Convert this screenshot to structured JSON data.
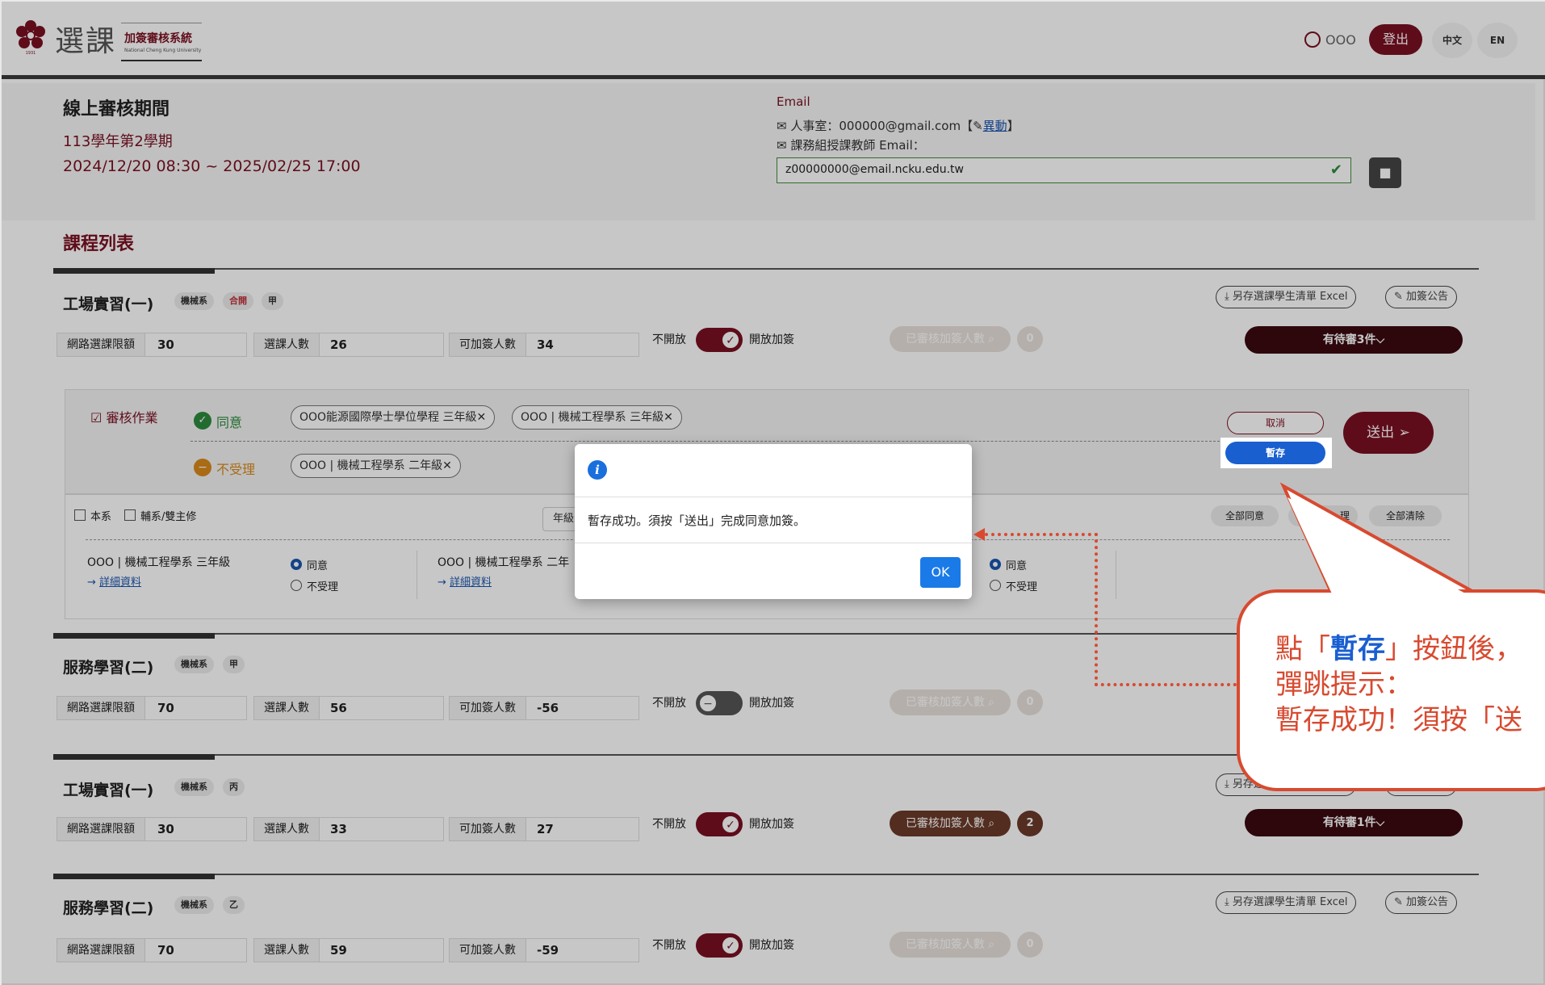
{
  "header": {
    "logo_main": "選課",
    "logo_sub": "加簽審核系統",
    "logo_tiny": "National Cheng Kung University",
    "user_name": "OOO",
    "logout_label": "登出",
    "lang_zh": "中文",
    "lang_en": "EN"
  },
  "period": {
    "title": "線上審核期間",
    "term": "113學年第2學期",
    "range": "2024/12/20 08:30 ~ 2025/02/25 17:00"
  },
  "email": {
    "label": "Email",
    "hr_line": "人事室：000000@gmail.com【",
    "hr_edit": "異動",
    "hr_close": "】",
    "teacher_line": "課務組授課教師 Email：",
    "teacher_value": "z00000000@email.ncku.edu.tw"
  },
  "list_title": "課程列表",
  "labels": {
    "limit": "網路選課限額",
    "enrolled": "選課人數",
    "addable": "可加簽人數",
    "closed": "不開放",
    "open": "開放加簽",
    "reviewed": "已審核加簽人數",
    "export": "另存選課學生清單 Excel",
    "announce": "加簽公告"
  },
  "courses": [
    {
      "name": "工場實習(一)",
      "tags": [
        "機械系",
        "合開",
        "甲"
      ],
      "limit": "30",
      "enrolled": "26",
      "addable": "34",
      "reviewed_count": "0",
      "pending": "有待審3件"
    },
    {
      "name": "服務學習(二)",
      "tags": [
        "機械系",
        "甲"
      ],
      "limit": "70",
      "enrolled": "56",
      "addable": "-56",
      "reviewed_count": "0"
    },
    {
      "name": "工場實習(一)",
      "tags": [
        "機械系",
        "丙"
      ],
      "limit": "30",
      "enrolled": "33",
      "addable": "27",
      "reviewed_count": "2",
      "pending": "有待審1件"
    },
    {
      "name": "服務學習(二)",
      "tags": [
        "機械系",
        "乙"
      ],
      "limit": "70",
      "enrolled": "59",
      "addable": "-59",
      "reviewed_count": "0"
    }
  ],
  "review": {
    "title": "審核作業",
    "agree_label": "同意",
    "reject_label": "不受理",
    "agree_chips": [
      "OOO能源國際學士學位學程 三年級",
      "OOO | 機械工程學系 三年級"
    ],
    "reject_chips": [
      "OOO | 機械工程學系 二年級"
    ],
    "cancel_label": "取消",
    "tempsave_label": "暫存",
    "send_label": "送出"
  },
  "students": {
    "filter_own": "本系",
    "filter_minor": "輔系/雙主修",
    "grade_label": "年級",
    "agree_all": "全部同意",
    "clear_all": "全部清除",
    "partial_reject": "理",
    "detail_link": "詳細資料",
    "opt_agree": "同意",
    "opt_reject": "不受理",
    "list": [
      {
        "name": "OOO | 機械工程學系 三年級"
      },
      {
        "name": "OOO | 機械工程學系 二年"
      }
    ]
  },
  "modal": {
    "message": "暫存成功。須按「送出」完成同意加簽。",
    "ok_label": "OK"
  },
  "callout": {
    "line1_pre": "點「",
    "line1_bold": "暫存",
    "line1_post": "」按鈕後，",
    "line2": "彈跳提示：",
    "line3": "暫存成功！須按「送"
  },
  "colors": {
    "brand": "#7a1022",
    "accent_blue": "#1a5fd0",
    "callout": "#d84a30"
  }
}
